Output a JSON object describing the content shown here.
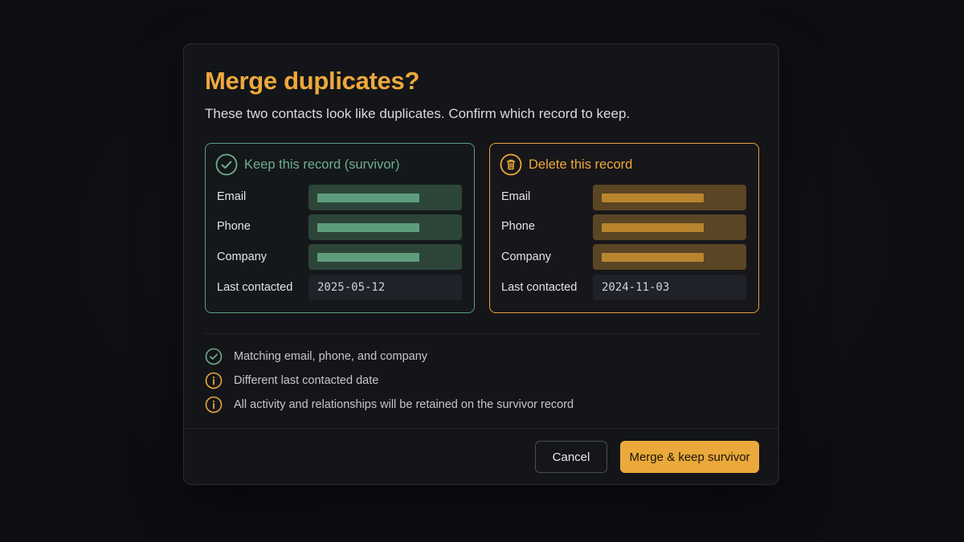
{
  "dialog": {
    "title": "Merge duplicates?",
    "subtitle": "These two contacts look like duplicates. Confirm which record to keep."
  },
  "survivor_card": {
    "heading": "Keep this record (survivor)",
    "icon": "check-circle-icon",
    "fields": {
      "email_label": "Email",
      "phone_label": "Phone",
      "company_label": "Company",
      "last_contacted_label": "Last contacted",
      "last_contacted_value": "2025-05-12"
    }
  },
  "delete_card": {
    "heading": "Delete this record",
    "icon": "trash-icon",
    "fields": {
      "email_label": "Email",
      "phone_label": "Phone",
      "company_label": "Company",
      "last_contacted_label": "Last contacted",
      "last_contacted_value": "2024-11-03"
    }
  },
  "notes": [
    {
      "icon": "check-circle-icon",
      "text": "Matching email, phone, and company"
    },
    {
      "icon": "info-icon",
      "text": "Different last contacted date"
    },
    {
      "icon": "info-icon",
      "text": "All activity and relationships will be retained on the survivor record"
    }
  ],
  "buttons": {
    "cancel": "Cancel",
    "confirm": "Merge & keep survivor"
  },
  "colors": {
    "accent": "#eea93a",
    "survivor_green": "#6fae8c",
    "background": "#0d0e12",
    "dialog_bg": "#141519"
  }
}
